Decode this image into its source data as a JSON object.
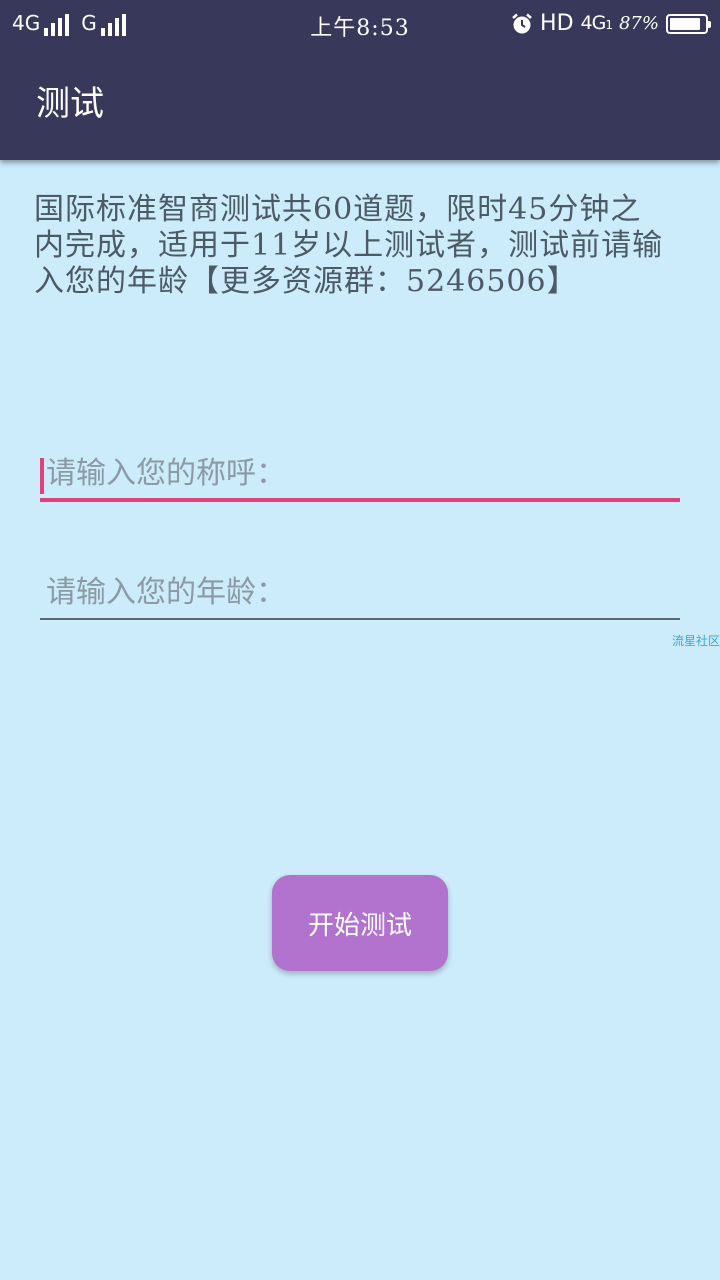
{
  "status_bar": {
    "network_left": "4G",
    "network_second": "G",
    "time": "上午8:53",
    "hd_label": "HD",
    "net_4g": "4G",
    "net_4g_sub": "1",
    "battery_percent": "87%",
    "battery_level": 0.87,
    "icons": [
      "signal-icon",
      "alarm-icon",
      "battery-icon"
    ]
  },
  "app_bar": {
    "title": "测试",
    "background_color": "#38385b"
  },
  "main": {
    "intro_text": "国际标准智商测试共60道题，限时45分钟之内完成，适用于11岁以上测试者，测试前请输入您的年龄【更多资源群：5246506】",
    "name_field": {
      "value": "",
      "placeholder": "请输入您的称呼："
    },
    "age_field": {
      "value": "",
      "placeholder": "请输入您的年龄："
    },
    "watermark": "流星社区",
    "start_button_label": "开始测试"
  },
  "colors": {
    "background": "#cdecfb",
    "accent": "#e2427c",
    "button": "#b173cd"
  }
}
